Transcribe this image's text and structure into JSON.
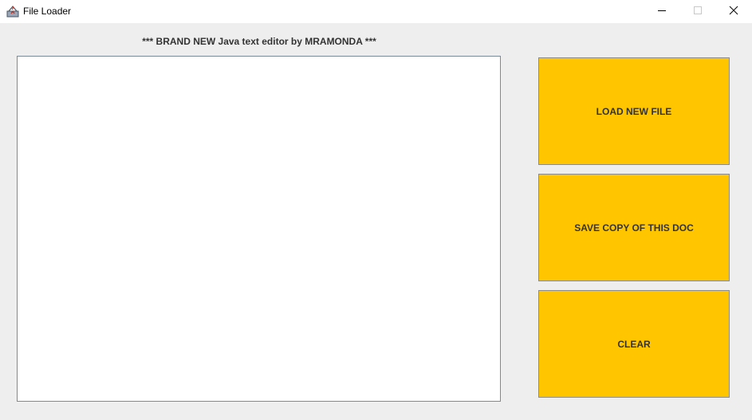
{
  "window": {
    "title": "File Loader",
    "icon": "java-app-icon",
    "controls": {
      "minimize": "minimize-icon",
      "maximize": "maximize-icon",
      "close": "close-icon"
    }
  },
  "main": {
    "heading": "*** BRAND NEW Java text editor by MRAMONDA ***",
    "editor_text": ""
  },
  "buttons": {
    "load_label": "LOAD NEW FILE",
    "save_label": "SAVE COPY OF THIS DOC",
    "clear_label": "CLEAR"
  },
  "colors": {
    "button_bg": "#ffc600",
    "window_bg": "#eeeeee",
    "titlebar_bg": "#ffffff"
  }
}
